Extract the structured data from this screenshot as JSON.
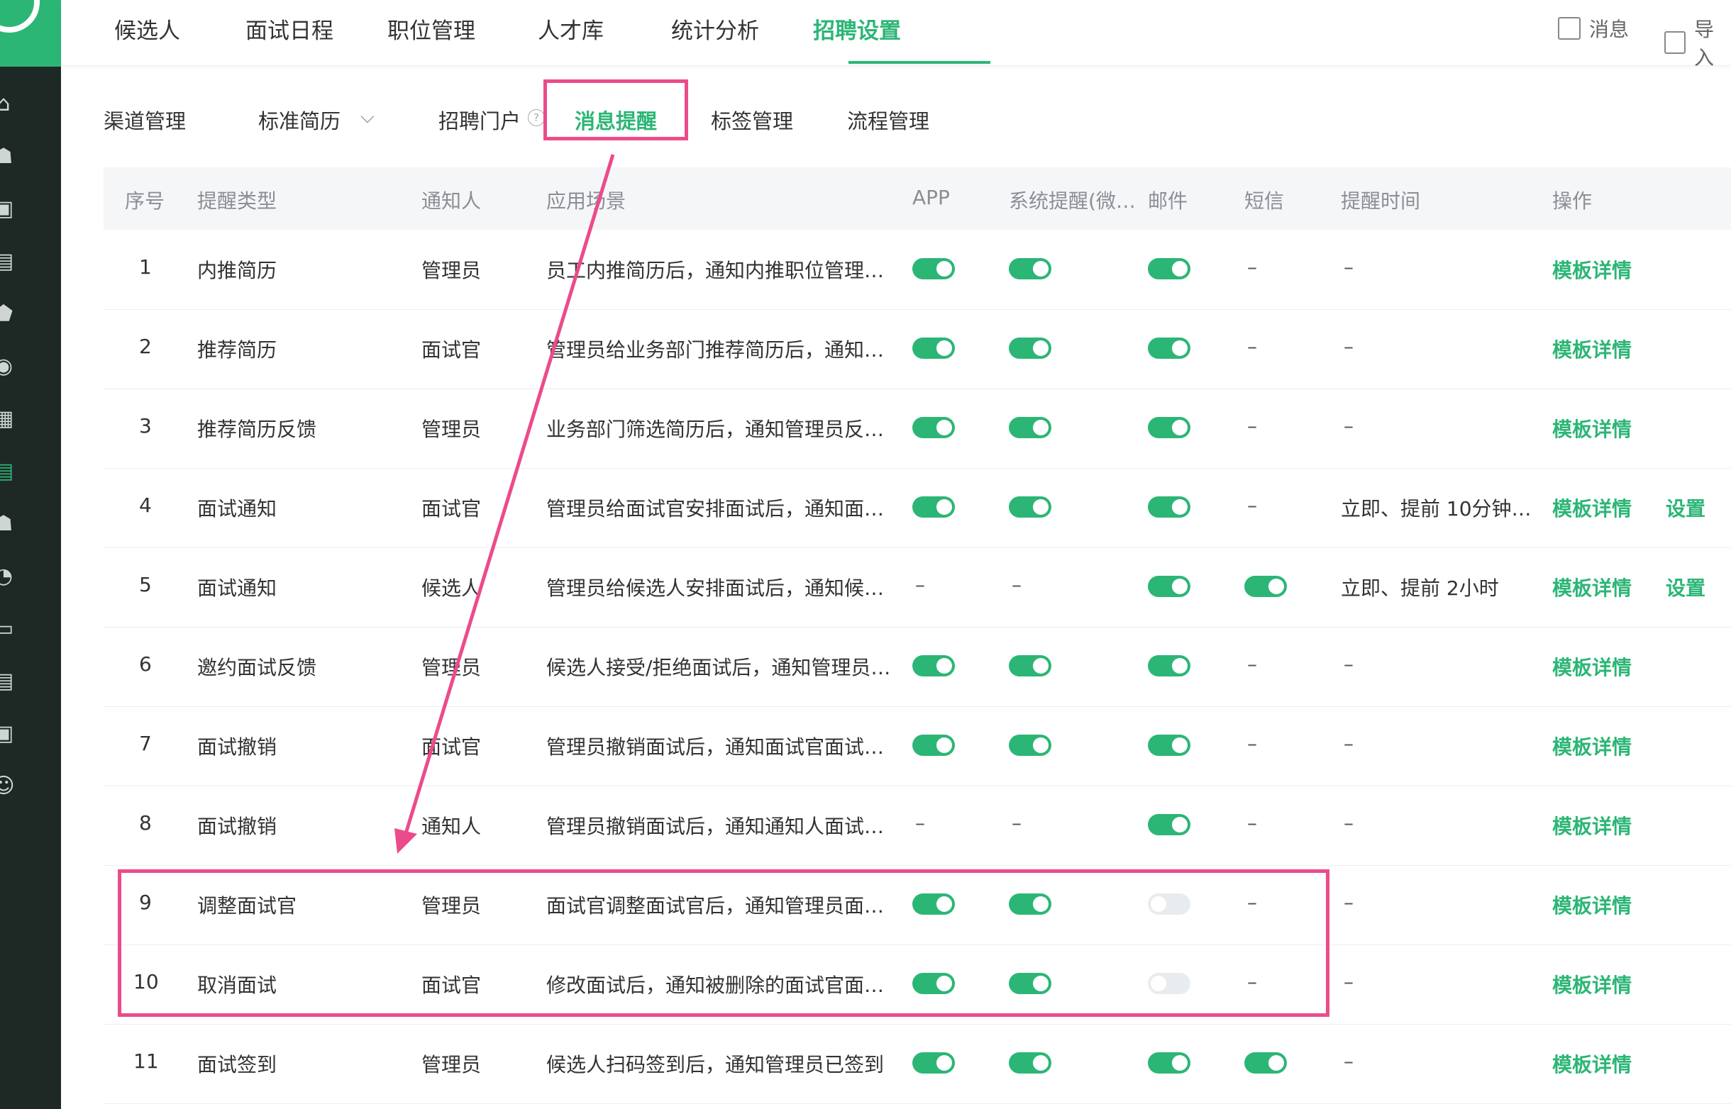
{
  "nav": {
    "tabs": [
      "候选人",
      "面试日程",
      "职位管理",
      "人才库",
      "统计分析",
      "招聘设置"
    ],
    "active_index": 5,
    "messages_label": "消息",
    "import_label": "导入"
  },
  "subtabs": {
    "items": [
      "渠道管理",
      "标准简历",
      "招聘门户",
      "消息提醒",
      "标签管理",
      "流程管理"
    ],
    "active_index": 3,
    "help_glyph": "?"
  },
  "table": {
    "headers": [
      "序号",
      "提醒类型",
      "通知人",
      "应用场景",
      "APP",
      "系统提醒(微…",
      "邮件",
      "短信",
      "提醒时间",
      "操作"
    ],
    "rows": [
      {
        "no": "1",
        "type": "内推简历",
        "notify": "管理员",
        "scene": "员工内推简历后，通知内推职位管理…",
        "app": true,
        "sys": true,
        "mail": true,
        "sms": null,
        "time": "–",
        "detail": "模板详情",
        "set": ""
      },
      {
        "no": "2",
        "type": "推荐简历",
        "notify": "面试官",
        "scene": "管理员给业务部门推荐简历后，通知…",
        "app": true,
        "sys": true,
        "mail": true,
        "sms": null,
        "time": "–",
        "detail": "模板详情",
        "set": ""
      },
      {
        "no": "3",
        "type": "推荐简历反馈",
        "notify": "管理员",
        "scene": "业务部门筛选简历后，通知管理员反…",
        "app": true,
        "sys": true,
        "mail": true,
        "sms": null,
        "time": "–",
        "detail": "模板详情",
        "set": ""
      },
      {
        "no": "4",
        "type": "面试通知",
        "notify": "面试官",
        "scene": "管理员给面试官安排面试后，通知面…",
        "app": true,
        "sys": true,
        "mail": true,
        "sms": null,
        "time": "立即、提前 10分钟…",
        "detail": "模板详情",
        "set": "设置"
      },
      {
        "no": "5",
        "type": "面试通知",
        "notify": "候选人",
        "scene": "管理员给候选人安排面试后，通知候…",
        "app": null,
        "sys": null,
        "mail": true,
        "sms": true,
        "time": "立即、提前 2小时",
        "detail": "模板详情",
        "set": "设置"
      },
      {
        "no": "6",
        "type": "邀约面试反馈",
        "notify": "管理员",
        "scene": "候选人接受/拒绝面试后，通知管理员…",
        "app": true,
        "sys": true,
        "mail": true,
        "sms": null,
        "time": "–",
        "detail": "模板详情",
        "set": ""
      },
      {
        "no": "7",
        "type": "面试撤销",
        "notify": "面试官",
        "scene": "管理员撤销面试后，通知面试官面试…",
        "app": true,
        "sys": true,
        "mail": true,
        "sms": null,
        "time": "–",
        "detail": "模板详情",
        "set": ""
      },
      {
        "no": "8",
        "type": "面试撤销",
        "notify": "通知人",
        "scene": "管理员撤销面试后，通知通知人面试…",
        "app": null,
        "sys": null,
        "mail": true,
        "sms": null,
        "time": "–",
        "detail": "模板详情",
        "set": ""
      },
      {
        "no": "9",
        "type": "调整面试官",
        "notify": "管理员",
        "scene": "面试官调整面试官后，通知管理员面…",
        "app": true,
        "sys": true,
        "mail": false,
        "sms": null,
        "time": "–",
        "detail": "模板详情",
        "set": ""
      },
      {
        "no": "10",
        "type": "取消面试",
        "notify": "面试官",
        "scene": "修改面试后，通知被删除的面试官面…",
        "app": true,
        "sys": true,
        "mail": false,
        "sms": null,
        "time": "–",
        "detail": "模板详情",
        "set": ""
      },
      {
        "no": "11",
        "type": "面试签到",
        "notify": "管理员",
        "scene": "候选人扫码签到后，通知管理员已签到",
        "app": true,
        "sys": true,
        "mail": true,
        "sms": true,
        "time": "–",
        "detail": "模板详情",
        "set": ""
      }
    ],
    "dash": "–"
  },
  "colors": {
    "accent": "#2cb676",
    "annotation": "#ec4b8b",
    "sidebar": "#1e2925"
  },
  "sidebar_icons": [
    "home-icon",
    "users-icon",
    "id-card-icon",
    "briefcase-icon",
    "shield-icon",
    "check-badge-icon",
    "settings-card-icon",
    "document-icon",
    "person-icon",
    "pie-chart-icon",
    "monitor-icon",
    "calendar-icon",
    "person-card-icon",
    "smile-icon"
  ]
}
